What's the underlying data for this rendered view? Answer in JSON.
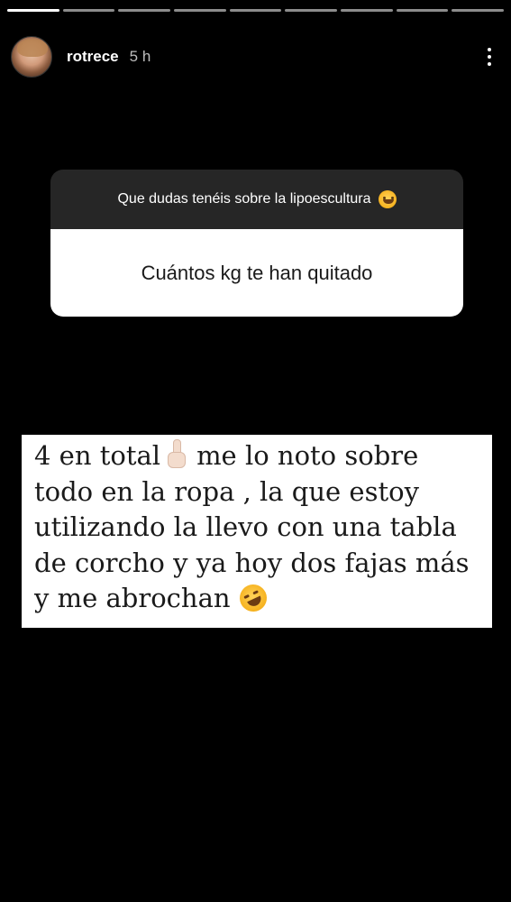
{
  "story": {
    "segment_count": 9,
    "active_segment": 0
  },
  "header": {
    "username": "rotrece",
    "time": "5 h",
    "more_icon": "more-vertical-icon"
  },
  "question": {
    "prompt": "Que dudas tenéis sobre la lipoescultura",
    "prompt_emoji": "smiling-face-with-hearts",
    "answer": "Cuántos kg te han quitado"
  },
  "reply": {
    "lines": [
      "4 en total",
      "me lo noto sobre",
      "todo en la ropa , la que estoy",
      "utilizando la llevo con una tabla",
      "de corcho y ya hoy dos fajas más",
      "y me abrochan"
    ],
    "emojis": [
      "crossed-fingers",
      "rolling-on-floor-laughing"
    ]
  }
}
